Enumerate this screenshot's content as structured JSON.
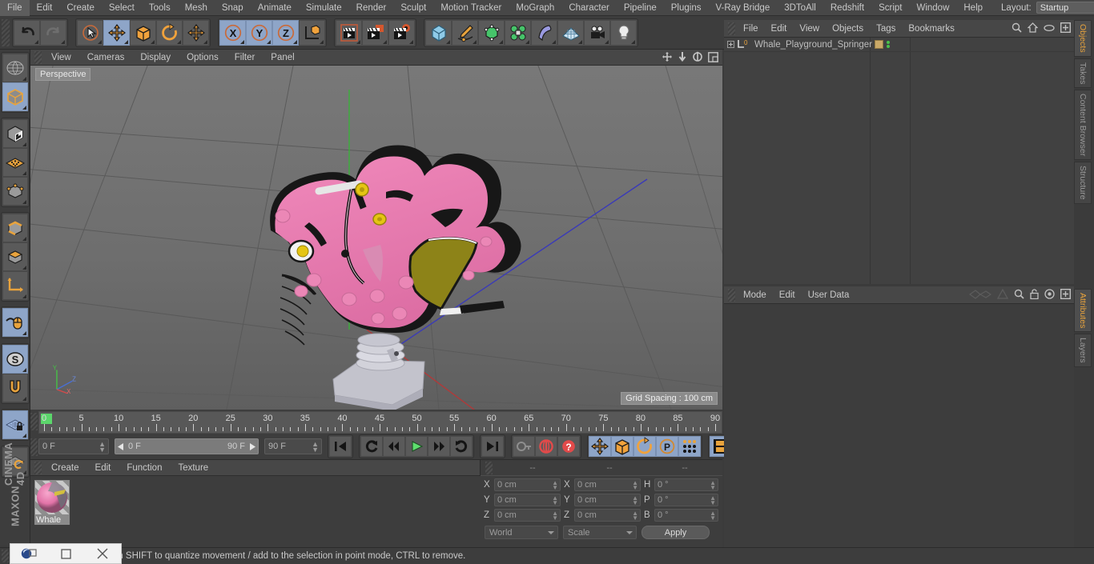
{
  "menubar": {
    "items": [
      "File",
      "Edit",
      "Create",
      "Select",
      "Tools",
      "Mesh",
      "Snap",
      "Animate",
      "Simulate",
      "Render",
      "Sculpt",
      "Motion Tracker",
      "MoGraph",
      "Character",
      "Pipeline",
      "Plugins",
      "V-Ray Bridge",
      "3DToAll",
      "Redshift",
      "Script",
      "Window",
      "Help"
    ],
    "layout_label": "Layout:",
    "layout_value": "Startup",
    "search_icon": "magnifier-icon"
  },
  "toolbar": {
    "groups": [
      {
        "name": "undo-redo",
        "buttons": [
          {
            "name": "undo-button",
            "icon": "undo-arrow-icon",
            "active": false
          },
          {
            "name": "redo-button",
            "icon": "redo-arrow-icon",
            "active": false,
            "disabled": true
          }
        ]
      },
      {
        "name": "transform-tools",
        "buttons": [
          {
            "name": "live-selection-tool",
            "icon": "cursor-circle-icon",
            "active": false
          },
          {
            "name": "move-tool",
            "icon": "move-arrows-icon",
            "active": true
          },
          {
            "name": "scale-tool",
            "icon": "scale-box-icon",
            "active": false
          },
          {
            "name": "rotate-tool",
            "icon": "rotate-arc-icon",
            "active": false
          },
          {
            "name": "dynamic-place-tool",
            "icon": "move-arrows-icon",
            "active": false
          }
        ]
      },
      {
        "name": "axis-locks",
        "buttons": [
          {
            "name": "lock-x-axis",
            "icon": "x-axis-icon",
            "active": true
          },
          {
            "name": "lock-y-axis",
            "icon": "y-axis-icon",
            "active": true
          },
          {
            "name": "lock-z-axis",
            "icon": "z-axis-icon",
            "active": true
          },
          {
            "name": "world-object-coord-toggle",
            "icon": "axis-cube-icon",
            "active": false
          }
        ]
      },
      {
        "name": "render-tools",
        "buttons": [
          {
            "name": "render-view-button",
            "icon": "clapper-view-icon",
            "active": false
          },
          {
            "name": "render-to-picture-viewer-button",
            "icon": "clapper-picture-icon",
            "active": false
          },
          {
            "name": "render-settings-button",
            "icon": "clapper-gear-icon",
            "active": false
          }
        ]
      },
      {
        "name": "create-objects",
        "buttons": [
          {
            "name": "add-primitive-cube-button",
            "icon": "blue-cube-icon",
            "active": false
          },
          {
            "name": "add-spline-button",
            "icon": "pen-spline-icon",
            "active": false
          },
          {
            "name": "add-generator-button",
            "icon": "green-cube-icon",
            "active": false
          },
          {
            "name": "add-array-button",
            "icon": "green-cluster-icon",
            "active": false
          },
          {
            "name": "add-deformer-button",
            "icon": "bend-deformer-icon",
            "active": false
          },
          {
            "name": "add-environment-button",
            "icon": "floor-grid-icon",
            "active": false
          },
          {
            "name": "add-camera-button",
            "icon": "camera-icon",
            "active": false
          },
          {
            "name": "add-light-button",
            "icon": "lightbulb-icon",
            "active": false
          }
        ]
      }
    ]
  },
  "left_toolbar": {
    "buttons": [
      {
        "name": "make-editable-button",
        "icon": "globe-wire-icon",
        "active": false
      },
      {
        "name": "model-mode-button",
        "icon": "grey-cube-icon",
        "active": true
      },
      {
        "name": "texture-mode-button",
        "icon": "checker-cube-icon",
        "active": false
      },
      {
        "name": "workplane-mode-button",
        "icon": "orange-plane-icon",
        "active": false
      },
      {
        "name": "points-mode-button",
        "icon": "cube-points-icon",
        "active": false
      },
      {
        "name": "edges-mode-button",
        "icon": "cube-edges-icon",
        "active": false
      },
      {
        "name": "polygons-mode-button",
        "icon": "cube-polygons-icon",
        "active": false
      },
      {
        "name": "object-axis-mode-button",
        "icon": "axis-corner-icon",
        "active": false
      },
      {
        "name": "enable-snapping-button",
        "icon": "mouse-icon",
        "active": true
      },
      {
        "name": "viewport-solo-button",
        "icon": "s-circle-icon",
        "active": true
      },
      {
        "name": "magnet-tool-button",
        "icon": "magnet-icon",
        "active": false
      },
      {
        "name": "workplane-lock-button",
        "icon": "grid-lock-icon",
        "active": true
      },
      {
        "name": "workplane-reset-button",
        "icon": "grid-reset-icon",
        "active": false
      }
    ],
    "brand_line1": "MAXON",
    "brand_line2": "CINEMA 4D"
  },
  "viewport": {
    "menu": [
      "View",
      "Cameras",
      "Display",
      "Options",
      "Filter",
      "Panel"
    ],
    "corner_icons": [
      "pan-view-icon",
      "dolly-view-icon",
      "rotate-view-icon",
      "maximize-view-icon"
    ],
    "label": "Perspective",
    "grid_spacing": "Grid Spacing : 100 cm",
    "axis_gizmo": {
      "y": "Y",
      "z": "Z",
      "x": "X"
    },
    "scene_colors": {
      "body_pink": "#e87ab0",
      "outline_black": "#141414",
      "seat_olive": "#8d8318",
      "eye_yellow": "#e5c513",
      "base_grey": "#c8c8d0",
      "handle_white": "#e4e4e4",
      "background": "#6e6e6e",
      "axis_x_red": "#b03a3a",
      "axis_z_blue": "#3a3ab0",
      "axis_y_green": "#3ab03a"
    }
  },
  "timeline": {
    "ruler_labels": [
      "0",
      "5",
      "10",
      "15",
      "20",
      "25",
      "30",
      "35",
      "40",
      "45",
      "50",
      "55",
      "60",
      "65",
      "70",
      "75",
      "80",
      "85",
      "90"
    ],
    "ruler_min": 0,
    "ruler_max": 90,
    "current_frame_field": "0 F",
    "range_start": "0 F",
    "range_end": "90 F",
    "max_frame_field": "90 F",
    "frame_field_right": "0 F",
    "transport": [
      {
        "name": "go-to-start-button",
        "icon": "skip-start-icon",
        "active": false
      },
      {
        "name": "play-backwards-loop-button",
        "icon": "loop-back-icon",
        "active": false
      },
      {
        "name": "step-back-button",
        "icon": "step-back-icon",
        "active": false
      },
      {
        "name": "play-button",
        "icon": "play-triangle-icon",
        "active": false
      },
      {
        "name": "step-forward-button",
        "icon": "step-forward-icon",
        "active": false
      },
      {
        "name": "play-forward-loop-button",
        "icon": "loop-forward-icon",
        "active": false
      },
      {
        "name": "go-to-end-button",
        "icon": "skip-end-icon",
        "active": false
      }
    ],
    "keyframe_tools": [
      {
        "name": "record-active-objects-button",
        "icon": "key-icon",
        "active": false
      },
      {
        "name": "autokeying-button",
        "icon": "red-circle-icon",
        "active": false
      },
      {
        "name": "keyframe-selection-button",
        "icon": "red-question-icon",
        "active": false
      }
    ],
    "key_filters": [
      {
        "name": "position-key-toggle",
        "icon": "move-arrows-icon",
        "active": true
      },
      {
        "name": "scale-key-toggle",
        "icon": "scale-box-icon",
        "active": true
      },
      {
        "name": "rotation-key-toggle",
        "icon": "rotate-arc-icon",
        "active": true
      },
      {
        "name": "parameter-key-toggle",
        "icon": "p-circle-icon",
        "active": true
      },
      {
        "name": "point-level-animation-toggle",
        "icon": "pla-dots-icon",
        "active": true
      },
      {
        "name": "timeline-view-toggle",
        "icon": "film-strip-icon",
        "active": true
      }
    ]
  },
  "material_manager": {
    "menu": [
      "Create",
      "Edit",
      "Function",
      "Texture"
    ],
    "materials": [
      {
        "name": "Whale"
      }
    ]
  },
  "coordinates": {
    "header_dashes": [
      "--",
      "--",
      "--"
    ],
    "rows": [
      {
        "pos_label": "X",
        "pos_value": "0 cm",
        "size_label": "X",
        "size_value": "0 cm",
        "rot_label": "H",
        "rot_value": "0 °"
      },
      {
        "pos_label": "Y",
        "pos_value": "0 cm",
        "size_label": "Y",
        "size_value": "0 cm",
        "rot_label": "P",
        "rot_value": "0 °"
      },
      {
        "pos_label": "Z",
        "pos_value": "0 cm",
        "size_label": "Z",
        "size_value": "0 cm",
        "rot_label": "B",
        "rot_value": "0 °"
      }
    ],
    "coord_system": "World",
    "size_mode": "Scale",
    "apply_label": "Apply"
  },
  "object_manager": {
    "menu": [
      "File",
      "Edit",
      "View",
      "Objects",
      "Tags",
      "Bookmarks"
    ],
    "header_icons": [
      "search-icon",
      "home-icon",
      "eye-icon",
      "expand-icon"
    ],
    "items": [
      {
        "name": "Whale_Playground_Springer",
        "layer_badge": "0",
        "expandable": true,
        "tag_color": "#c9a968"
      }
    ]
  },
  "attribute_manager": {
    "menu": [
      "Mode",
      "Edit",
      "User Data"
    ],
    "header_icons": [
      "interpolation-icon",
      "triangle-icon",
      "search-icon",
      "lock-icon",
      "target-icon",
      "expand-icon"
    ]
  },
  "right_tabs": {
    "top": [
      {
        "label": "Objects",
        "active": true
      },
      {
        "label": "Takes",
        "active": false
      },
      {
        "label": "Content Browser",
        "active": false
      },
      {
        "label": "Structure",
        "active": false
      }
    ],
    "bottom": [
      {
        "label": "Attributes",
        "active": true
      },
      {
        "label": "Layers",
        "active": false
      }
    ]
  },
  "statusbar": {
    "text": "Move elements. Hold down SHIFT to quantize movement / add to the selection in point mode, CTRL to remove."
  },
  "os_taskbar": {
    "app_icon": "c4d-app-icon",
    "restore_icon": "restore-window-icon",
    "minimize_icon": "minimize-window-icon",
    "close_icon": "close-window-icon"
  }
}
